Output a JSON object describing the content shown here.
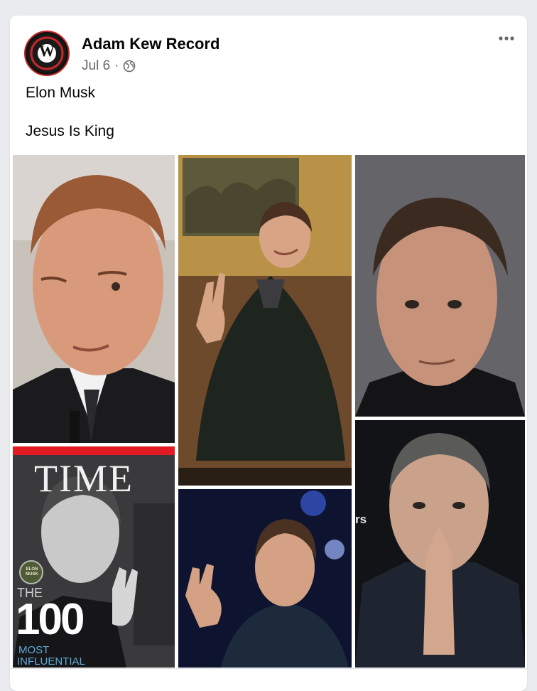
{
  "post": {
    "author": "Adam Kew Record",
    "date": "Jul 6",
    "separator": "·",
    "privacy_icon": "globe-icon",
    "more_icon": "more-options-icon",
    "text_line1": "Elon Musk",
    "text_line2": "Jesus Is King",
    "avatar_letter": "W"
  },
  "photos": {
    "magazine_masthead": "TIME",
    "magazine_cover_line1": "THE",
    "magazine_cover_number": "100",
    "magazine_cover_line2": "MOST",
    "magazine_cover_line3": "INFLUENTIAL",
    "magazine_badge": "ELON MUSK",
    "fragment_text": "rs"
  },
  "colors": {
    "card_bg": "#ffffff",
    "page_bg": "#e9ebee",
    "meta_text": "#65676b",
    "time_red": "#e21b23"
  }
}
